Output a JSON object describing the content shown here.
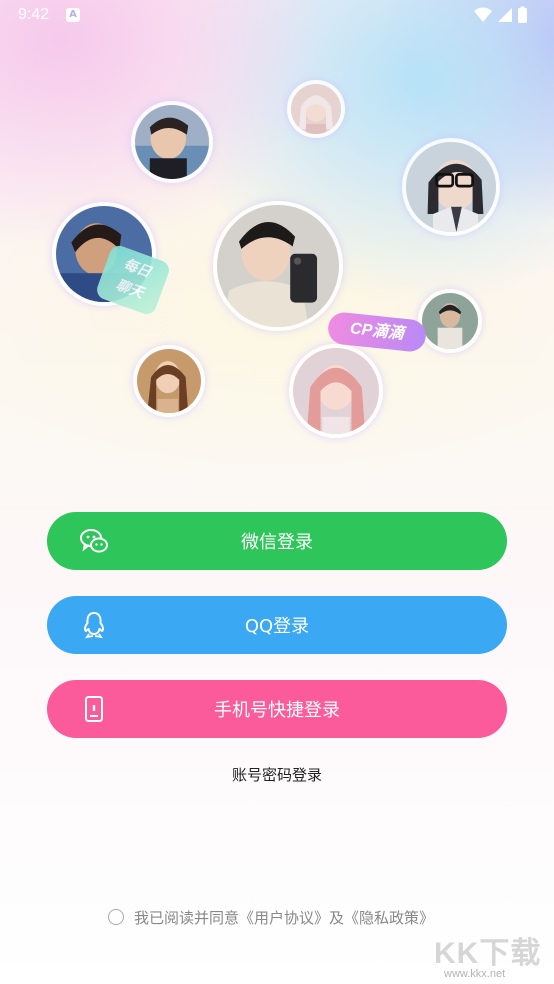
{
  "status_bar": {
    "time": "9:42",
    "indicator": "A",
    "icons": [
      "wifi-icon",
      "signal-icon",
      "battery-icon"
    ]
  },
  "tags": {
    "cp": "CP滴滴",
    "chat": "每日\n聊天"
  },
  "buttons": {
    "wechat": "微信登录",
    "qq": "QQ登录",
    "phone": "手机号快捷登录"
  },
  "account_login": "账号密码登录",
  "agreement": {
    "prefix": "我已阅读并同意",
    "user_agreement": "《用户协议》",
    "and": "及",
    "privacy": "《隐私政策》"
  },
  "watermark": {
    "text": "KK下载",
    "url": "www.kkx.net"
  },
  "colors": {
    "wechat": "#2ec55a",
    "qq": "#3aa8f2",
    "phone": "#fb5b9a"
  }
}
